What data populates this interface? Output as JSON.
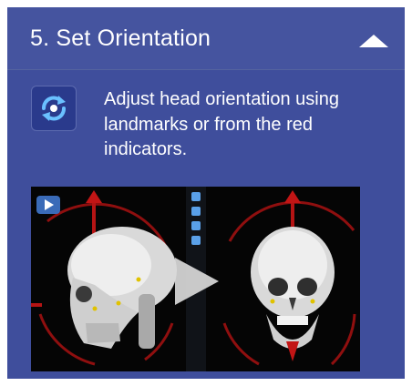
{
  "section": {
    "title": "5. Set Orientation",
    "collapse_icon": "chevron-up-icon",
    "step_icon": "rotate-icon",
    "description": "Adjust head orientation using landmarks or from the red indicators."
  },
  "video": {
    "play_icon": "play-icon",
    "badge_icon": "youtube-icon"
  },
  "colors": {
    "panel": "#3f4e9c",
    "accent": "#2a3a8c",
    "indicator": "#c21515"
  }
}
